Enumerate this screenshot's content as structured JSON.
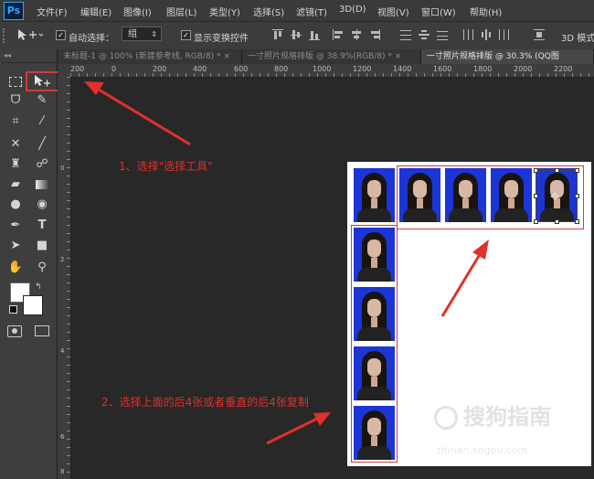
{
  "app": {
    "logo": "Ps"
  },
  "menu": [
    "文件(F)",
    "编辑(E)",
    "图像(I)",
    "图层(L)",
    "类型(Y)",
    "选择(S)",
    "滤镜(T)",
    "3D(D)",
    "视图(V)",
    "窗口(W)",
    "帮助(H)"
  ],
  "options": {
    "auto_select_label": "自动选择：",
    "auto_select_checked": true,
    "auto_select_value": "组",
    "show_transform_label": "显示变换控件",
    "show_transform_checked": true,
    "mode_label": "3D 模式"
  },
  "tabs": [
    {
      "label": "未标题-1 @ 100% (新建参考线, RGB/8) *",
      "active": false
    },
    {
      "label": "一寸照片规格排版 @ 38.9%(RGB/8) *",
      "active": false
    },
    {
      "label": "一寸照片规格排版 @ 30.3% (QQ图",
      "active": true
    }
  ],
  "ruler_top": [
    "200",
    "0",
    "200",
    "400",
    "600",
    "800",
    "1000",
    "1200",
    "1400",
    "1600",
    "1800",
    "2000",
    "2200"
  ],
  "ruler_left": [
    "0",
    "2",
    "4",
    "6",
    "8"
  ],
  "annotations": {
    "step1": "1、选择\"选择工具\"",
    "step2": "2、选择上面的后4张或者垂直的后4张复制"
  },
  "watermark": {
    "brand": "搜狗指南",
    "url": "zhinan.sogou.com"
  },
  "colors": {
    "accent_red": "#e0312b",
    "photo_bg": "#1c35d6",
    "canvas": "#ffffff"
  },
  "icons": [
    "marquee-icon",
    "move-icon",
    "lasso-icon",
    "quick-select-icon",
    "crop-icon",
    "eyedropper-icon",
    "healing-icon",
    "brush-icon",
    "stamp-icon",
    "history-brush-icon",
    "eraser-icon",
    "gradient-icon",
    "blur-icon",
    "dodge-icon",
    "pen-icon",
    "type-icon",
    "path-select-icon",
    "rectangle-icon",
    "hand-icon",
    "zoom-icon",
    "quick-mask-icon",
    "screen-mode-icon"
  ]
}
